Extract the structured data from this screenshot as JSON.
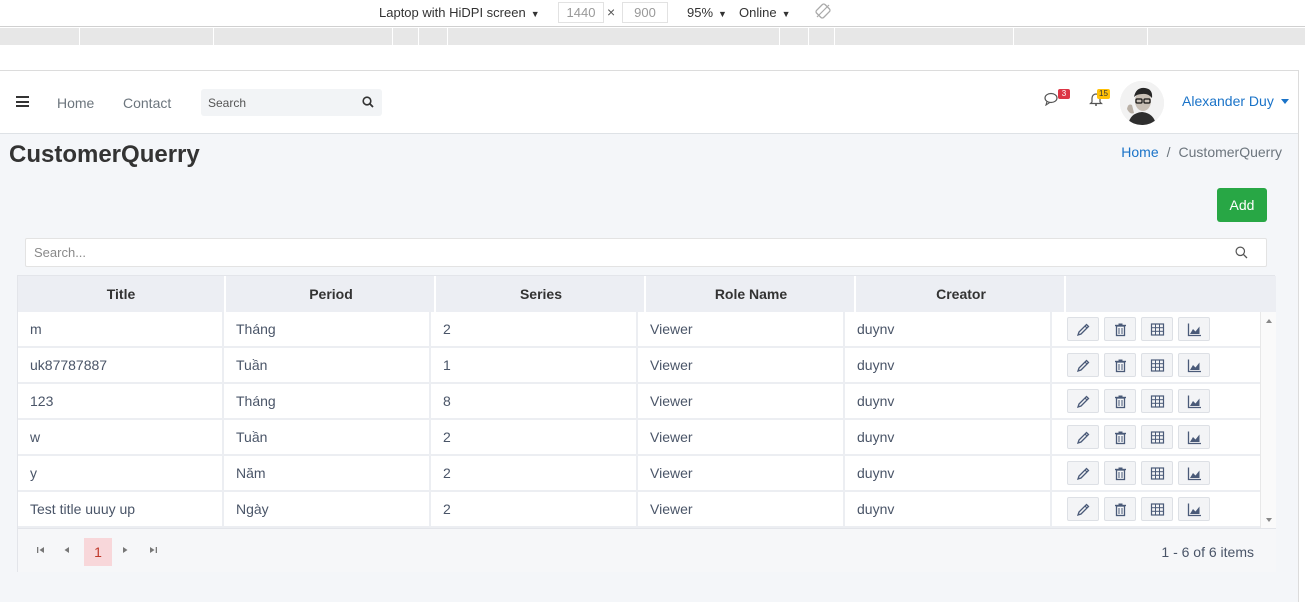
{
  "devtools": {
    "device": "Laptop with HiDPI screen",
    "width": "1440",
    "height": "900",
    "times": "×",
    "zoom": "95%",
    "network": "Online"
  },
  "navbar": {
    "home": "Home",
    "contact": "Contact",
    "search_placeholder": "Search",
    "messages_count": "3",
    "notifications_count": "15",
    "user_name": "Alexander Duy"
  },
  "page": {
    "title": "CustomerQuerry",
    "breadcrumb_home": "Home",
    "breadcrumb_sep": "/",
    "breadcrumb_current": "CustomerQuerry",
    "add_label": "Add",
    "grid_search_placeholder": "Search..."
  },
  "grid": {
    "columns": [
      "Title",
      "Period",
      "Series",
      "Role Name",
      "Creator"
    ],
    "rows": [
      [
        "m",
        "Tháng",
        "2",
        "Viewer",
        "duynv"
      ],
      [
        "uk87787887",
        "Tuần",
        "1",
        "Viewer",
        "duynv"
      ],
      [
        "123",
        "Tháng",
        "8",
        "Viewer",
        "duynv"
      ],
      [
        "w",
        "Tuần",
        "2",
        "Viewer",
        "duynv"
      ],
      [
        "y",
        "Năm",
        "2",
        "Viewer",
        "duynv"
      ],
      [
        "Test title uuuy up",
        "Ngày",
        "2",
        "Viewer",
        "duynv"
      ]
    ]
  },
  "pager": {
    "current_page": "1",
    "info": "1 - 6 of 6 items"
  },
  "colors": {
    "accent": "#1a73c8",
    "add_button": "#28a745",
    "badge_red": "#dc3545",
    "badge_yellow": "#ffc107"
  }
}
